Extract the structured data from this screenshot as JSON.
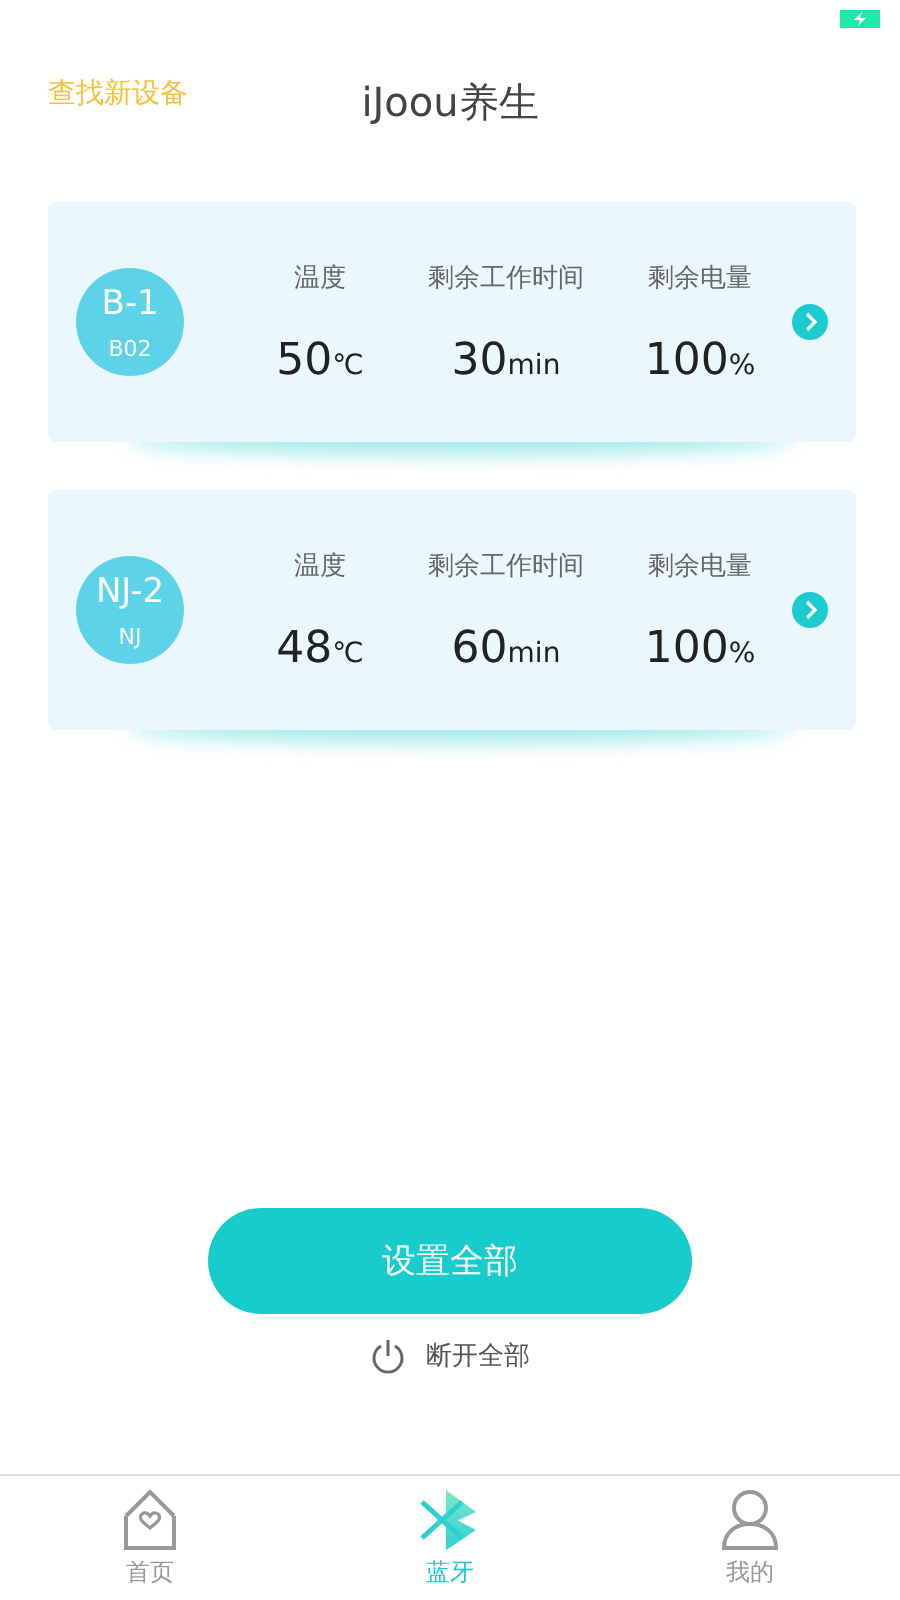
{
  "header": {
    "find_link": "查找新设备",
    "title": "iJoou养生"
  },
  "devices": [
    {
      "name": "B-1",
      "code": "B02",
      "stats": [
        {
          "label": "温度",
          "value": "50",
          "unit": "℃"
        },
        {
          "label": "剩余工作时间",
          "value": "30",
          "unit": "min"
        },
        {
          "label": "剩余电量",
          "value": "100",
          "unit": "%"
        }
      ]
    },
    {
      "name": "NJ-2",
      "code": "NJ",
      "stats": [
        {
          "label": "温度",
          "value": "48",
          "unit": "℃"
        },
        {
          "label": "剩余工作时间",
          "value": "60",
          "unit": "min"
        },
        {
          "label": "剩余电量",
          "value": "100",
          "unit": "%"
        }
      ]
    }
  ],
  "set_all_button": "设置全部",
  "disconnect_all": "断开全部",
  "tabs": [
    {
      "label": "首页",
      "kind": "home",
      "selected": false
    },
    {
      "label": "蓝牙",
      "kind": "bluetooth",
      "selected": true
    },
    {
      "label": "我的",
      "kind": "profile",
      "selected": false
    }
  ]
}
